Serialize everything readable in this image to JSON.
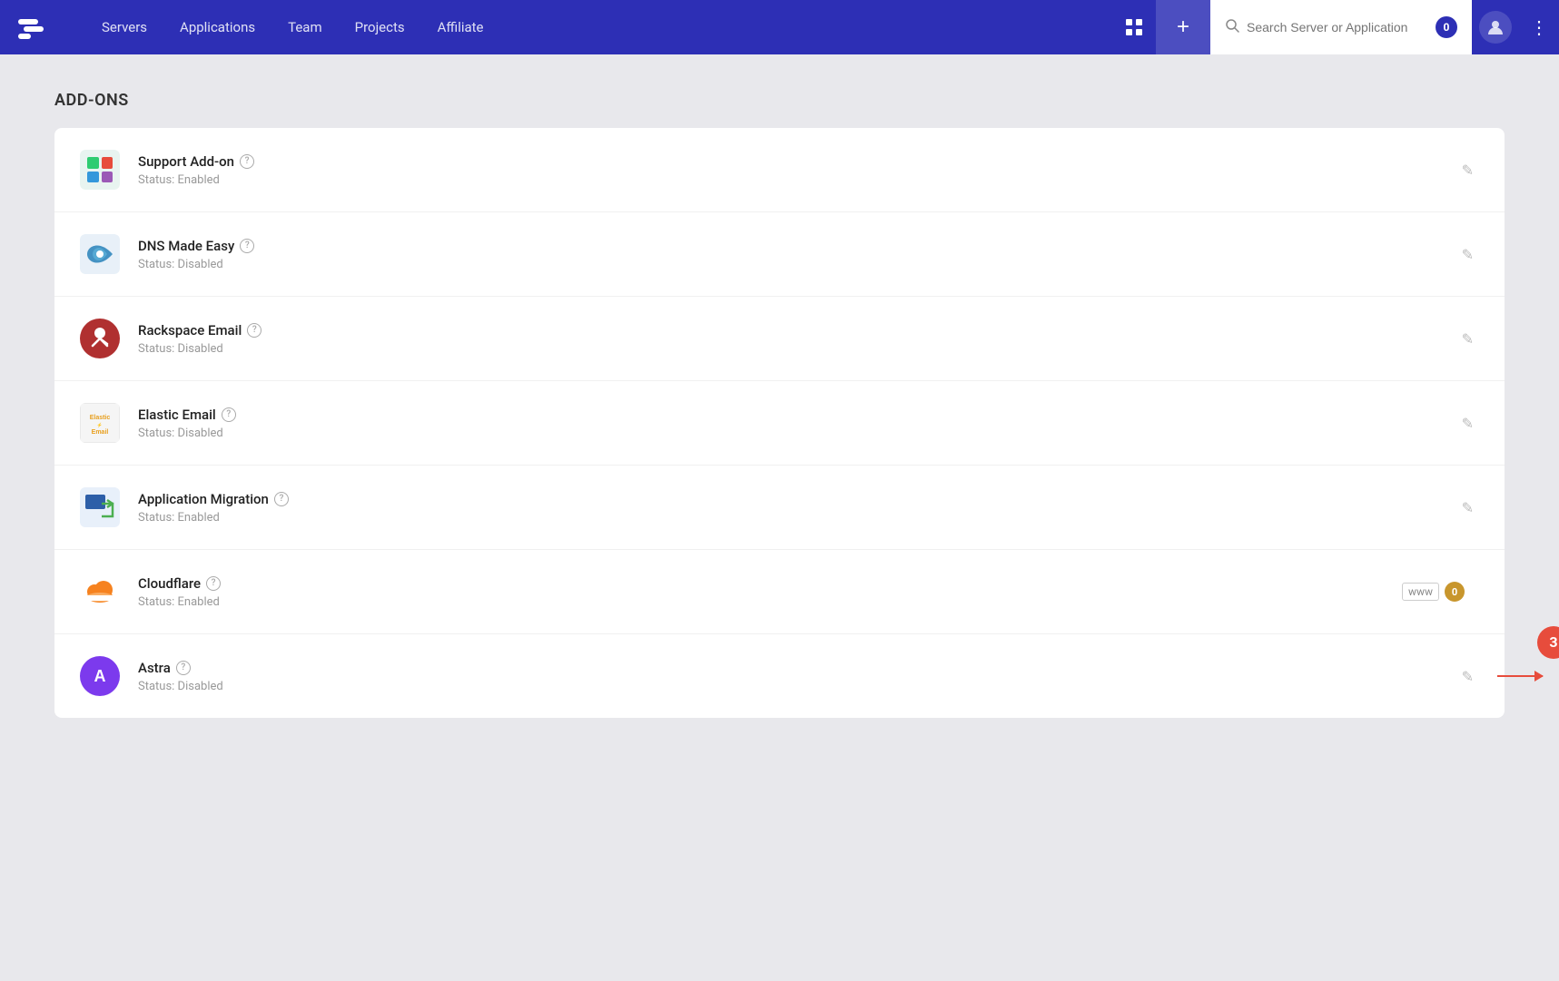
{
  "navbar": {
    "links": [
      {
        "label": "Servers",
        "name": "servers"
      },
      {
        "label": "Applications",
        "name": "applications"
      },
      {
        "label": "Team",
        "name": "team"
      },
      {
        "label": "Projects",
        "name": "projects"
      },
      {
        "label": "Affiliate",
        "name": "affiliate"
      }
    ],
    "plus_label": "+",
    "search_placeholder": "Search Server or Application",
    "notification_count": "0",
    "dots_label": "⋮"
  },
  "page": {
    "section_title": "ADD-ONS"
  },
  "addons": [
    {
      "id": "support",
      "name": "Support Add-on",
      "status": "Status: Enabled",
      "logo_type": "support"
    },
    {
      "id": "dns",
      "name": "DNS Made Easy",
      "status": "Status: Disabled",
      "logo_type": "dns"
    },
    {
      "id": "rackspace",
      "name": "Rackspace Email",
      "status": "Status: Disabled",
      "logo_type": "rackspace"
    },
    {
      "id": "elastic",
      "name": "Elastic Email",
      "status": "Status: Disabled",
      "logo_type": "elastic"
    },
    {
      "id": "migration",
      "name": "Application Migration",
      "status": "Status: Enabled",
      "logo_type": "migration"
    },
    {
      "id": "cloudflare",
      "name": "Cloudflare",
      "status": "Status: Enabled",
      "logo_type": "cloudflare",
      "has_www": true,
      "www_count": "0"
    },
    {
      "id": "astra",
      "name": "Astra",
      "status": "Status: Disabled",
      "logo_type": "astra",
      "has_step": true,
      "step_number": "3"
    }
  ],
  "labels": {
    "help": "?",
    "www": "www",
    "edit": "✎"
  }
}
